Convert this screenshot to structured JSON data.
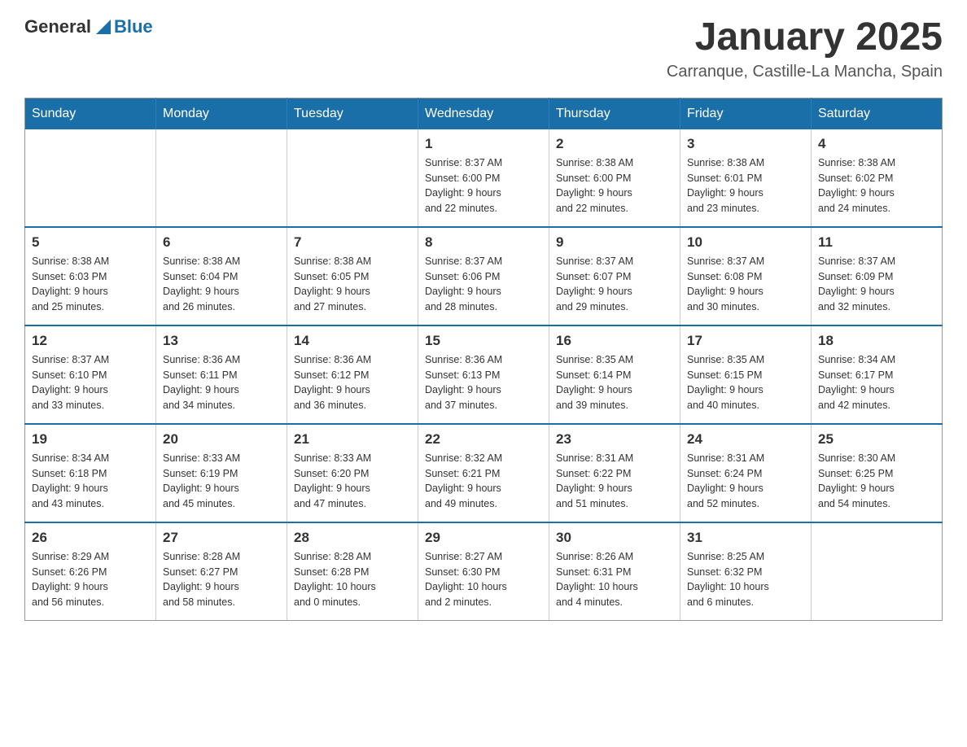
{
  "logo": {
    "general": "General",
    "blue": "Blue"
  },
  "header": {
    "title": "January 2025",
    "location": "Carranque, Castille-La Mancha, Spain"
  },
  "weekdays": [
    "Sunday",
    "Monday",
    "Tuesday",
    "Wednesday",
    "Thursday",
    "Friday",
    "Saturday"
  ],
  "weeks": [
    [
      {
        "day": "",
        "info": ""
      },
      {
        "day": "",
        "info": ""
      },
      {
        "day": "",
        "info": ""
      },
      {
        "day": "1",
        "info": "Sunrise: 8:37 AM\nSunset: 6:00 PM\nDaylight: 9 hours\nand 22 minutes."
      },
      {
        "day": "2",
        "info": "Sunrise: 8:38 AM\nSunset: 6:00 PM\nDaylight: 9 hours\nand 22 minutes."
      },
      {
        "day": "3",
        "info": "Sunrise: 8:38 AM\nSunset: 6:01 PM\nDaylight: 9 hours\nand 23 minutes."
      },
      {
        "day": "4",
        "info": "Sunrise: 8:38 AM\nSunset: 6:02 PM\nDaylight: 9 hours\nand 24 minutes."
      }
    ],
    [
      {
        "day": "5",
        "info": "Sunrise: 8:38 AM\nSunset: 6:03 PM\nDaylight: 9 hours\nand 25 minutes."
      },
      {
        "day": "6",
        "info": "Sunrise: 8:38 AM\nSunset: 6:04 PM\nDaylight: 9 hours\nand 26 minutes."
      },
      {
        "day": "7",
        "info": "Sunrise: 8:38 AM\nSunset: 6:05 PM\nDaylight: 9 hours\nand 27 minutes."
      },
      {
        "day": "8",
        "info": "Sunrise: 8:37 AM\nSunset: 6:06 PM\nDaylight: 9 hours\nand 28 minutes."
      },
      {
        "day": "9",
        "info": "Sunrise: 8:37 AM\nSunset: 6:07 PM\nDaylight: 9 hours\nand 29 minutes."
      },
      {
        "day": "10",
        "info": "Sunrise: 8:37 AM\nSunset: 6:08 PM\nDaylight: 9 hours\nand 30 minutes."
      },
      {
        "day": "11",
        "info": "Sunrise: 8:37 AM\nSunset: 6:09 PM\nDaylight: 9 hours\nand 32 minutes."
      }
    ],
    [
      {
        "day": "12",
        "info": "Sunrise: 8:37 AM\nSunset: 6:10 PM\nDaylight: 9 hours\nand 33 minutes."
      },
      {
        "day": "13",
        "info": "Sunrise: 8:36 AM\nSunset: 6:11 PM\nDaylight: 9 hours\nand 34 minutes."
      },
      {
        "day": "14",
        "info": "Sunrise: 8:36 AM\nSunset: 6:12 PM\nDaylight: 9 hours\nand 36 minutes."
      },
      {
        "day": "15",
        "info": "Sunrise: 8:36 AM\nSunset: 6:13 PM\nDaylight: 9 hours\nand 37 minutes."
      },
      {
        "day": "16",
        "info": "Sunrise: 8:35 AM\nSunset: 6:14 PM\nDaylight: 9 hours\nand 39 minutes."
      },
      {
        "day": "17",
        "info": "Sunrise: 8:35 AM\nSunset: 6:15 PM\nDaylight: 9 hours\nand 40 minutes."
      },
      {
        "day": "18",
        "info": "Sunrise: 8:34 AM\nSunset: 6:17 PM\nDaylight: 9 hours\nand 42 minutes."
      }
    ],
    [
      {
        "day": "19",
        "info": "Sunrise: 8:34 AM\nSunset: 6:18 PM\nDaylight: 9 hours\nand 43 minutes."
      },
      {
        "day": "20",
        "info": "Sunrise: 8:33 AM\nSunset: 6:19 PM\nDaylight: 9 hours\nand 45 minutes."
      },
      {
        "day": "21",
        "info": "Sunrise: 8:33 AM\nSunset: 6:20 PM\nDaylight: 9 hours\nand 47 minutes."
      },
      {
        "day": "22",
        "info": "Sunrise: 8:32 AM\nSunset: 6:21 PM\nDaylight: 9 hours\nand 49 minutes."
      },
      {
        "day": "23",
        "info": "Sunrise: 8:31 AM\nSunset: 6:22 PM\nDaylight: 9 hours\nand 51 minutes."
      },
      {
        "day": "24",
        "info": "Sunrise: 8:31 AM\nSunset: 6:24 PM\nDaylight: 9 hours\nand 52 minutes."
      },
      {
        "day": "25",
        "info": "Sunrise: 8:30 AM\nSunset: 6:25 PM\nDaylight: 9 hours\nand 54 minutes."
      }
    ],
    [
      {
        "day": "26",
        "info": "Sunrise: 8:29 AM\nSunset: 6:26 PM\nDaylight: 9 hours\nand 56 minutes."
      },
      {
        "day": "27",
        "info": "Sunrise: 8:28 AM\nSunset: 6:27 PM\nDaylight: 9 hours\nand 58 minutes."
      },
      {
        "day": "28",
        "info": "Sunrise: 8:28 AM\nSunset: 6:28 PM\nDaylight: 10 hours\nand 0 minutes."
      },
      {
        "day": "29",
        "info": "Sunrise: 8:27 AM\nSunset: 6:30 PM\nDaylight: 10 hours\nand 2 minutes."
      },
      {
        "day": "30",
        "info": "Sunrise: 8:26 AM\nSunset: 6:31 PM\nDaylight: 10 hours\nand 4 minutes."
      },
      {
        "day": "31",
        "info": "Sunrise: 8:25 AM\nSunset: 6:32 PM\nDaylight: 10 hours\nand 6 minutes."
      },
      {
        "day": "",
        "info": ""
      }
    ]
  ]
}
